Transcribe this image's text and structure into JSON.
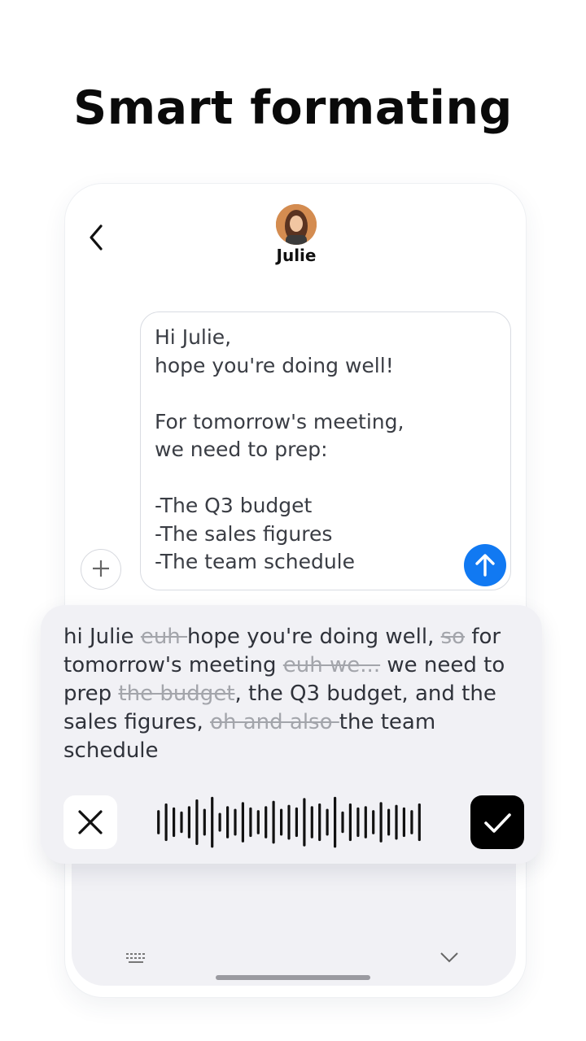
{
  "headline": "Smart formating",
  "chat": {
    "contact_name": "Julie",
    "message": "Hi Julie,\nhope you're doing well!\n\nFor tomorrow's meeting,\nwe need to prep:\n\n-The Q3 budget\n-The sales figures\n-The team schedule"
  },
  "transcript": [
    {
      "text": "hi Julie ",
      "deleted": false
    },
    {
      "text": "euh ",
      "deleted": true
    },
    {
      "text": "hope you're doing well, ",
      "deleted": false
    },
    {
      "text": "so",
      "deleted": true
    },
    {
      "text": " for tomorrow's meeting ",
      "deleted": false
    },
    {
      "text": "euh we...",
      "deleted": true
    },
    {
      "text": " we need to prep ",
      "deleted": false
    },
    {
      "text": "the budget",
      "deleted": true
    },
    {
      "text": ", the Q3 budget, and the sales figures, ",
      "deleted": false
    },
    {
      "text": "oh and also ",
      "deleted": true
    },
    {
      "text": "the team schedule",
      "deleted": false
    }
  ],
  "waveform_levels": [
    0.45,
    0.7,
    0.55,
    0.4,
    0.6,
    0.85,
    0.5,
    0.95,
    0.35,
    0.6,
    0.5,
    0.75,
    0.55,
    0.45,
    0.6,
    0.8,
    0.5,
    0.65,
    0.55,
    0.9,
    0.6,
    0.7,
    0.5,
    0.95,
    0.4,
    0.7,
    0.55,
    0.6,
    0.45,
    0.75,
    0.5,
    0.65,
    0.55,
    0.45,
    0.7
  ],
  "colors": {
    "send": "#1179f2",
    "confirm": "#000000",
    "deleted_text": "#a3a5ab"
  },
  "icons": {
    "back": "chevron-left-icon",
    "attach": "plus-icon",
    "send": "arrow-up-icon",
    "cancel": "close-icon",
    "confirm": "check-icon",
    "keyboard": "keyboard-icon",
    "collapse": "chevron-down-icon"
  }
}
